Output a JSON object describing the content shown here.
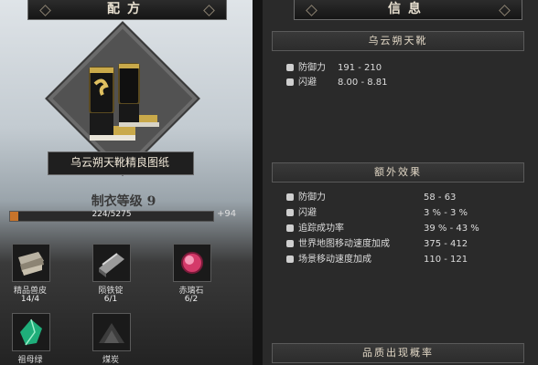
{
  "left_panel": {
    "tab_title": "配方",
    "item_name": "乌云朔天靴精良图纸",
    "craft_level_label": "制衣等级",
    "craft_level_value": "9",
    "progress_text": "224/5275",
    "progress_fraction": 0.042,
    "progress_gain": "+94",
    "materials": [
      {
        "name": "精品兽皮",
        "count": "14/4",
        "icon": "leather-icon"
      },
      {
        "name": "陨铁锭",
        "count": "6/1",
        "icon": "ingot-icon"
      },
      {
        "name": "赤璃石",
        "count": "6/2",
        "icon": "red-gem-icon"
      },
      {
        "name": "祖母绿",
        "count": "",
        "icon": "emerald-icon"
      },
      {
        "name": "煤炭",
        "count": "",
        "icon": "coal-icon"
      }
    ]
  },
  "right_panel": {
    "tab_title": "信息",
    "item_title": "乌云朔天靴",
    "base_stats": [
      {
        "icon": "shield-icon",
        "label": "防御力",
        "value": "191 - 210"
      },
      {
        "icon": "boot-icon",
        "label": "闪避",
        "value": "8.00 - 8.81"
      }
    ],
    "extra_title": "额外效果",
    "extra_stats": [
      {
        "icon": "shield-icon",
        "label": "防御力",
        "value": "58 - 63"
      },
      {
        "icon": "boot-icon",
        "label": "闪避",
        "value": "3 % - 3 %"
      },
      {
        "icon": "target-icon",
        "label": "追踪成功率",
        "value": "39 % - 43 %"
      },
      {
        "icon": "world-map-icon",
        "label": "世界地图移动速度加成",
        "value": "375 - 412"
      },
      {
        "icon": "run-icon",
        "label": "场景移动速度加成",
        "value": "110 - 121"
      }
    ],
    "quality_title": "品质出现概率"
  },
  "colors": {
    "progress_fill": "#c8742a",
    "gold": "#c9a94a"
  }
}
